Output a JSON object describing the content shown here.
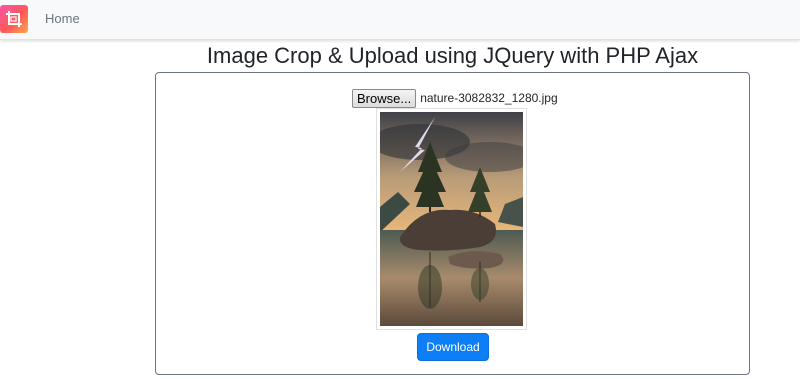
{
  "navbar": {
    "brand_icon": "crop-icon",
    "home_label": "Home"
  },
  "page": {
    "title": "Image Crop & Upload using JQuery with PHP Ajax"
  },
  "upload": {
    "browse_label": "Browse...",
    "file_name": "nature-3082832_1280.jpg"
  },
  "preview": {
    "image": "landscape-photo-icon"
  },
  "actions": {
    "download_label": "Download"
  },
  "colors": {
    "primary": "#0d7ef5",
    "brand_gradient_start": "#f857a6",
    "brand_gradient_end": "#ffa84d",
    "navbar_bg": "#f8f9fa"
  }
}
